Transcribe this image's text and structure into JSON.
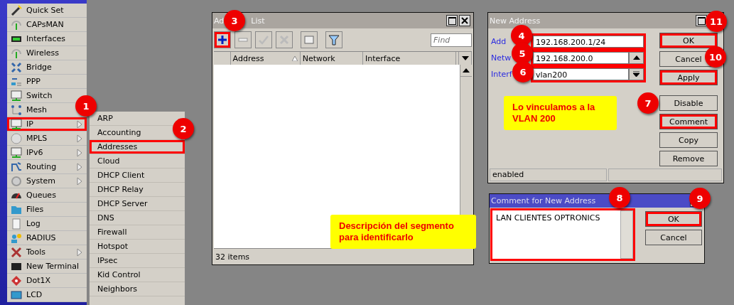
{
  "sidebar": {
    "items": [
      {
        "label": "Quick Set",
        "submenu": false,
        "highlighted": false
      },
      {
        "label": "CAPsMAN",
        "submenu": false,
        "highlighted": false
      },
      {
        "label": "Interfaces",
        "submenu": false,
        "highlighted": false
      },
      {
        "label": "Wireless",
        "submenu": false,
        "highlighted": false
      },
      {
        "label": "Bridge",
        "submenu": false,
        "highlighted": false
      },
      {
        "label": "PPP",
        "submenu": false,
        "highlighted": false
      },
      {
        "label": "Switch",
        "submenu": false,
        "highlighted": false
      },
      {
        "label": "Mesh",
        "submenu": false,
        "highlighted": false
      },
      {
        "label": "IP",
        "submenu": true,
        "highlighted": true
      },
      {
        "label": "MPLS",
        "submenu": true,
        "highlighted": false
      },
      {
        "label": "IPv6",
        "submenu": true,
        "highlighted": false
      },
      {
        "label": "Routing",
        "submenu": true,
        "highlighted": false
      },
      {
        "label": "System",
        "submenu": true,
        "highlighted": false
      },
      {
        "label": "Queues",
        "submenu": false,
        "highlighted": false
      },
      {
        "label": "Files",
        "submenu": false,
        "highlighted": false
      },
      {
        "label": "Log",
        "submenu": false,
        "highlighted": false
      },
      {
        "label": "RADIUS",
        "submenu": false,
        "highlighted": false
      },
      {
        "label": "Tools",
        "submenu": true,
        "highlighted": false
      },
      {
        "label": "New Terminal",
        "submenu": false,
        "highlighted": false
      },
      {
        "label": "Dot1X",
        "submenu": false,
        "highlighted": false
      },
      {
        "label": "LCD",
        "submenu": false,
        "highlighted": false
      }
    ]
  },
  "submenu": {
    "items": [
      {
        "label": "ARP",
        "highlighted": false
      },
      {
        "label": "Accounting",
        "highlighted": false
      },
      {
        "label": "Addresses",
        "highlighted": true
      },
      {
        "label": "Cloud",
        "highlighted": false
      },
      {
        "label": "DHCP Client",
        "highlighted": false
      },
      {
        "label": "DHCP Relay",
        "highlighted": false
      },
      {
        "label": "DHCP Server",
        "highlighted": false
      },
      {
        "label": "DNS",
        "highlighted": false
      },
      {
        "label": "Firewall",
        "highlighted": false
      },
      {
        "label": "Hotspot",
        "highlighted": false
      },
      {
        "label": "IPsec",
        "highlighted": false
      },
      {
        "label": "Kid Control",
        "highlighted": false
      },
      {
        "label": "Neighbors",
        "highlighted": false
      }
    ]
  },
  "address_list": {
    "title_parts": [
      "Ad",
      "List"
    ],
    "toolbar": [
      {
        "kind": "add",
        "highlighted": true
      },
      {
        "kind": "remove",
        "highlighted": false
      },
      {
        "kind": "enable",
        "highlighted": false
      },
      {
        "kind": "disable",
        "highlighted": false
      },
      {
        "kind": "comment",
        "highlighted": false
      },
      {
        "kind": "filter",
        "highlighted": false
      }
    ],
    "search": {
      "placeholder": "Find"
    },
    "columns": [
      "Address",
      "Network",
      "Interface"
    ],
    "status": "32 items"
  },
  "new_address": {
    "title": "New Address",
    "fields": [
      {
        "label": "Add",
        "value": "192.168.200.1/24",
        "kind": "text",
        "highlighted": true
      },
      {
        "label": "Netw",
        "value": "192.168.200.0",
        "kind": "up",
        "highlighted": true
      },
      {
        "label": "Interf",
        "value": "vlan200",
        "kind": "dropdown",
        "highlighted": true
      }
    ],
    "buttons": [
      {
        "label": "OK",
        "highlighted": true
      },
      {
        "label": "Cancel",
        "highlighted": false
      },
      {
        "label": "Apply",
        "highlighted": true
      }
    ],
    "actions": [
      {
        "label": "Disable",
        "highlighted": false
      },
      {
        "label": "Comment",
        "highlighted": true
      },
      {
        "label": "Copy",
        "highlighted": false
      },
      {
        "label": "Remove",
        "highlighted": false
      }
    ],
    "status": "enabled"
  },
  "comment_window": {
    "title": "Comment for New Address",
    "value": "LAN CLIENTES OPTRONICS",
    "text_highlighted": true,
    "buttons": [
      {
        "label": "OK",
        "highlighted": true
      },
      {
        "label": "Cancel",
        "highlighted": false
      }
    ]
  },
  "notes": [
    "Lo vinculamos a la VLAN 200",
    "Descripción del segmento para identificarlo"
  ],
  "badges": [
    "1",
    "2",
    "3",
    "4",
    "5",
    "6",
    "7",
    "8",
    "9",
    "10",
    "11"
  ]
}
